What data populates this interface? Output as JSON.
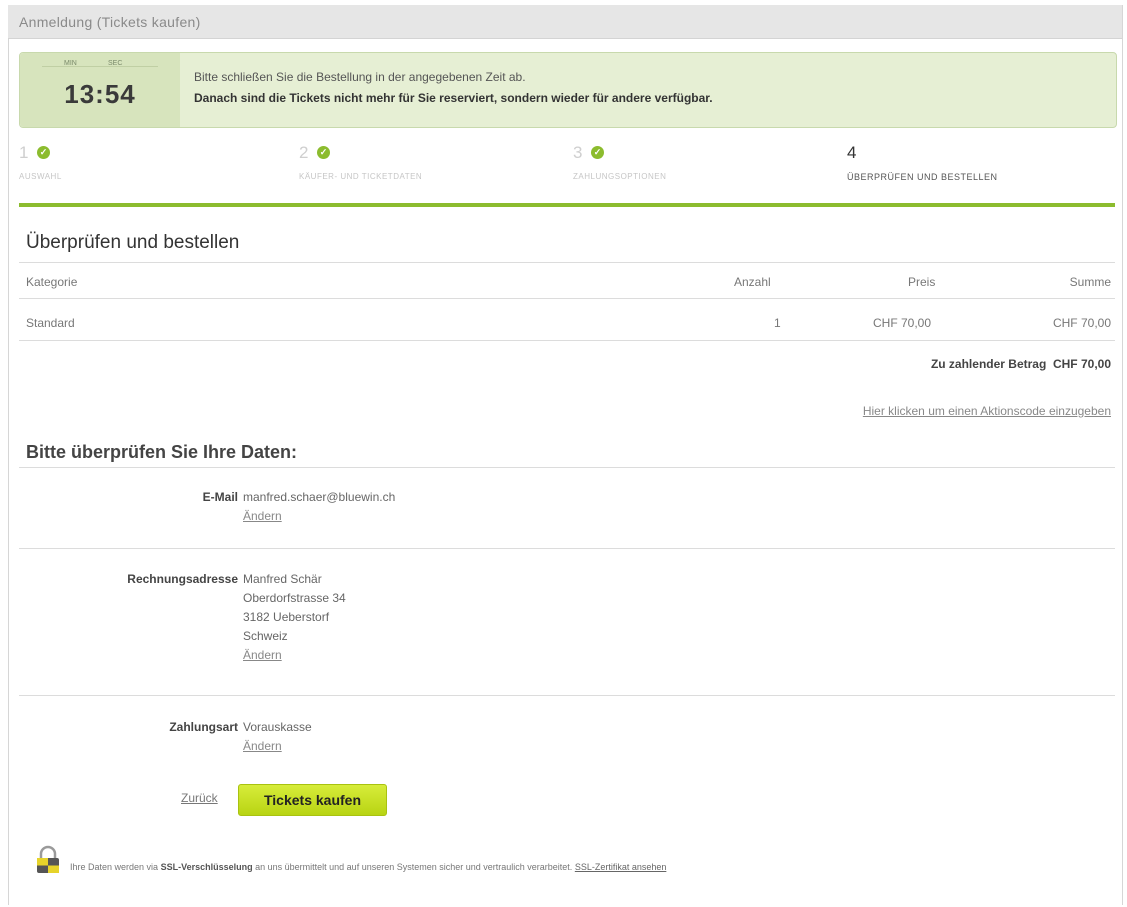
{
  "window": {
    "title": "Anmeldung (Tickets kaufen)"
  },
  "timer": {
    "min_label": "MIN",
    "sec_label": "SEC",
    "time": "13:54",
    "message1": "Bitte schließen Sie die Bestellung in der angegebenen Zeit ab.",
    "message2": "Danach sind die Tickets nicht mehr für Sie reserviert, sondern wieder für andere verfügbar."
  },
  "steps": [
    {
      "number": "1",
      "label": "AUSWAHL",
      "done": true
    },
    {
      "number": "2",
      "label": "KÄUFER- UND TICKETDATEN",
      "done": true
    },
    {
      "number": "3",
      "label": "ZAHLUNGSOPTIONEN",
      "done": true
    },
    {
      "number": "4",
      "label": "ÜBERPRÜFEN UND BESTELLEN",
      "done": false,
      "active": true
    }
  ],
  "review": {
    "title": "Überprüfen und bestellen",
    "columns": {
      "category": "Kategorie",
      "quantity": "Anzahl",
      "price": "Preis",
      "sum": "Summe"
    },
    "rows": [
      {
        "category": "Standard",
        "quantity": "1",
        "price": "CHF 70,00",
        "sum": "CHF 70,00"
      }
    ],
    "total_label": "Zu zahlender Betrag",
    "total_value": "CHF 70,00",
    "promo_link": "Hier klicken um einen Aktionscode einzugeben"
  },
  "data": {
    "title": "Bitte überprüfen Sie Ihre Daten:",
    "email_label": "E-Mail",
    "email_value": "manfred.schaer@bluewin.ch",
    "address_label": "Rechnungsadresse",
    "address_lines": [
      "Manfred Schär",
      "Oberdorfstrasse 34",
      "3182 Ueberstorf",
      "Schweiz"
    ],
    "payment_label": "Zahlungsart",
    "payment_value": "Vorauskasse",
    "change_label": "Ändern"
  },
  "actions": {
    "back": "Zurück",
    "buy": "Tickets kaufen"
  },
  "ssl": {
    "prefix": "Ihre Daten werden via",
    "bold": "SSL-Verschlüsselung",
    "middle": "an uns übermittelt und auf unseren Systemen sicher und vertraulich verarbeitet.",
    "link": "SSL-Zertifikat ansehen"
  },
  "colors": {
    "accent_green": "#8cbc2e",
    "button_yellow": "#c6e02a",
    "notice_bg": "#e6efd4"
  }
}
